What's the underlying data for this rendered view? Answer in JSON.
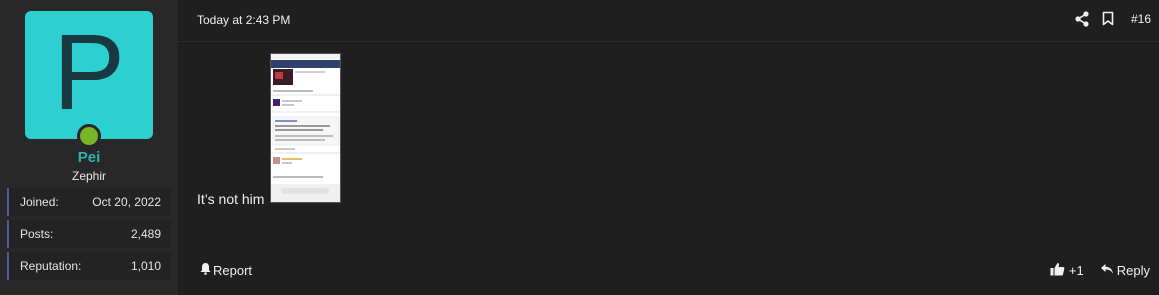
{
  "user": {
    "avatar_letter": "P",
    "avatar_color": "#2ecfd0",
    "online_color": "#7ab527",
    "name": "Pei",
    "name_color": "#2bb3b3",
    "title": "Zephir",
    "stats": [
      {
        "label": "Joined:",
        "value": "Oct 20, 2022"
      },
      {
        "label": "Posts:",
        "value": "2,489"
      },
      {
        "label": "Reputation:",
        "value": "1,010"
      }
    ]
  },
  "post": {
    "timestamp": "Today at 2:43 PM",
    "number": "#16",
    "body": "It’s not him",
    "attachment_icon": "screenshot-thumbnail"
  },
  "footer": {
    "report_label": "Report",
    "reaction_count": "+1",
    "reply_label": "Reply"
  },
  "icons": {
    "share": "share-icon",
    "bookmark": "bookmark-icon",
    "report": "bell-icon",
    "like": "thumbs-up-icon",
    "reply": "reply-icon"
  }
}
